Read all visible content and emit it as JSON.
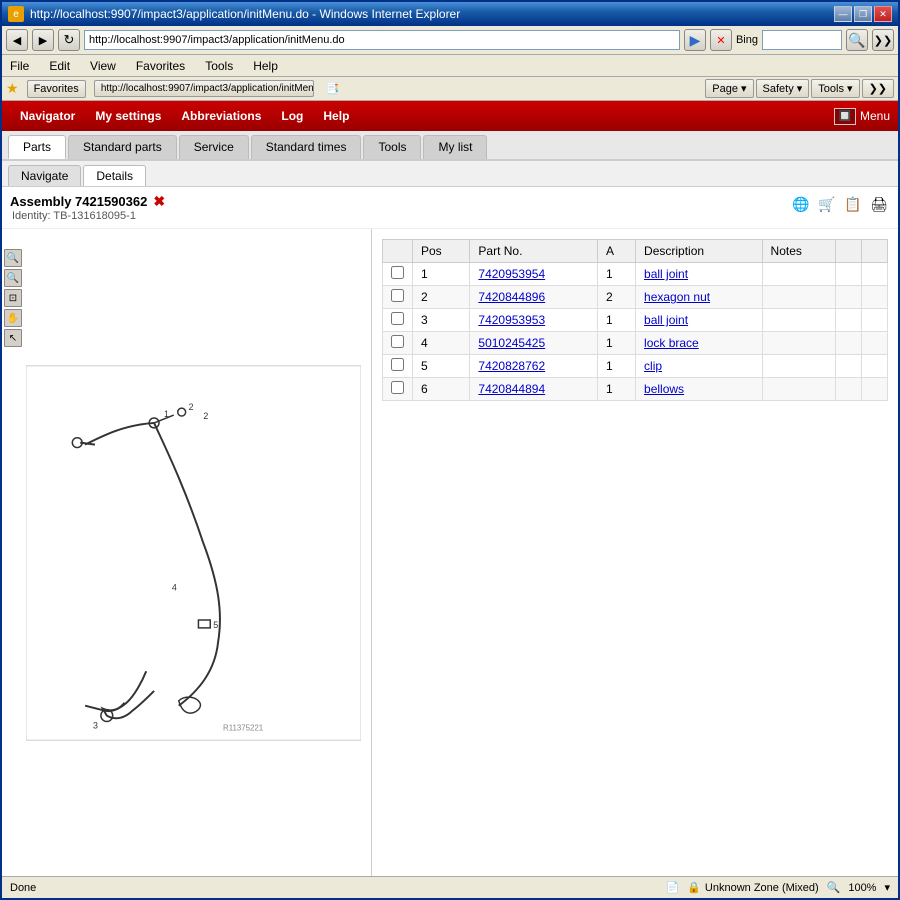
{
  "browser": {
    "title": "http://localhost:9907/impact3/application/initMenu.do - Windows Internet Explorer",
    "url": "http://localhost:9907/impact3/application/initMenu.do",
    "search_engine": "Bing",
    "buttons": {
      "minimize": "—",
      "restore": "❐",
      "close": "✕",
      "back": "◀",
      "forward": "▶",
      "refresh": "↻",
      "stop": "✕"
    }
  },
  "menu_bar": {
    "items": [
      "File",
      "Edit",
      "View",
      "Favorites",
      "Tools",
      "Help"
    ]
  },
  "favorites_bar": {
    "label": "Favorites",
    "url_btn": "http://localhost:9907/impact3/application/initMenu.do",
    "right_buttons": [
      "Page ▾",
      "Safety ▾",
      "Tools ▾",
      "❯❯"
    ]
  },
  "app": {
    "nav_items": [
      "Navigator",
      "My settings",
      "Abbreviations",
      "Log",
      "Help"
    ],
    "logo": "Menu",
    "tabs": [
      "Parts",
      "Standard parts",
      "Service",
      "Standard times",
      "Tools",
      "My list"
    ],
    "active_tab": "Parts",
    "sub_tabs": [
      "Navigate",
      "Details"
    ],
    "active_sub_tab": "Details"
  },
  "assembly": {
    "title": "Assembly 7421590362",
    "identity": "Identity: TB-131618095-1"
  },
  "parts": [
    {
      "pos": "1",
      "part_no": "7420953954",
      "a": "1",
      "description": "ball joint",
      "notes": ""
    },
    {
      "pos": "2",
      "part_no": "7420844896",
      "a": "2",
      "description": "hexagon nut",
      "notes": ""
    },
    {
      "pos": "3",
      "part_no": "7420953953",
      "a": "1",
      "description": "ball joint",
      "notes": ""
    },
    {
      "pos": "4",
      "part_no": "5010245425",
      "a": "1",
      "description": "lock brace",
      "notes": ""
    },
    {
      "pos": "5",
      "part_no": "7420828762",
      "a": "1",
      "description": "clip",
      "notes": ""
    },
    {
      "pos": "6",
      "part_no": "7420844894",
      "a": "1",
      "description": "bellows",
      "notes": ""
    }
  ],
  "table_headers": [
    "",
    "Pos",
    "Part No.",
    "A",
    "Description",
    "Notes",
    "",
    ""
  ],
  "status": {
    "left": "Done",
    "zone": "Unknown Zone (Mixed)",
    "zoom": "100%"
  },
  "diagram": {
    "ref": "R11375221"
  }
}
